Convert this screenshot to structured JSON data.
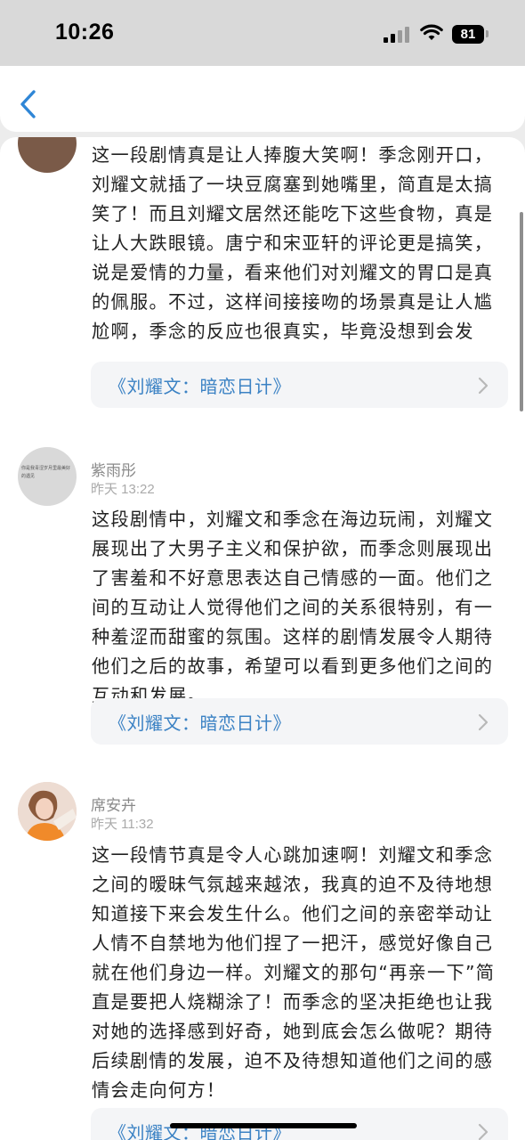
{
  "status_bar": {
    "time": "10:26",
    "battery": "81"
  },
  "nav": {
    "back_icon": "chevron-left-icon"
  },
  "comments": [
    {
      "text": "这一段剧情真是让人捧腹大笑啊！季念刚开口，刘耀文就插了一块豆腐塞到她嘴里，简直是太搞笑了！而且刘耀文居然还能吃下这些食物，真是让人大跌眼镜。唐宁和宋亚轩的评论更是搞笑，说是爱情的力量，看来他们对刘耀文的胃口是真的佩服。不过，这样间接接吻的场景真是让人尴尬啊，季念的反应也很真实，毕竟没想到会发",
      "book": "《刘耀文：暗恋日计》"
    },
    {
      "name": "紫雨彤",
      "date": "昨天 13:22",
      "avatar_text": "你是我青涩岁月里最美好的遇见",
      "text": "这段剧情中，刘耀文和季念在海边玩闹，刘耀文展现出了大男子主义和保护欲，而季念则展现出了害羞和不好意思表达自己情感的一面。他们之间的互动让人觉得他们之间的关系很特别，有一种羞涩而甜蜜的氛围。这样的剧情发展令人期待他们之后的故事，希望可以看到更多他们之间的互动和发展。",
      "book": "《刘耀文：暗恋日计》"
    },
    {
      "name": "席安卉",
      "date": "昨天 11:32",
      "text": "这一段情节真是令人心跳加速啊！刘耀文和季念之间的暧昧气氛越来越浓，我真的迫不及待地想知道接下来会发生什么。他们之间的亲密举动让人情不自禁地为他们捏了一把汗，感觉好像自己就在他们身边一样。刘耀文的那句“再亲一下”简直是要把人烧糊涂了！而季念的坚决拒绝也让我对她的选择感到好奇，她到底会怎么做呢？期待后续剧情的发展，迫不及待想知道他们之间的感情会走向何方！",
      "book": "《刘耀文：暗恋日计》"
    }
  ]
}
